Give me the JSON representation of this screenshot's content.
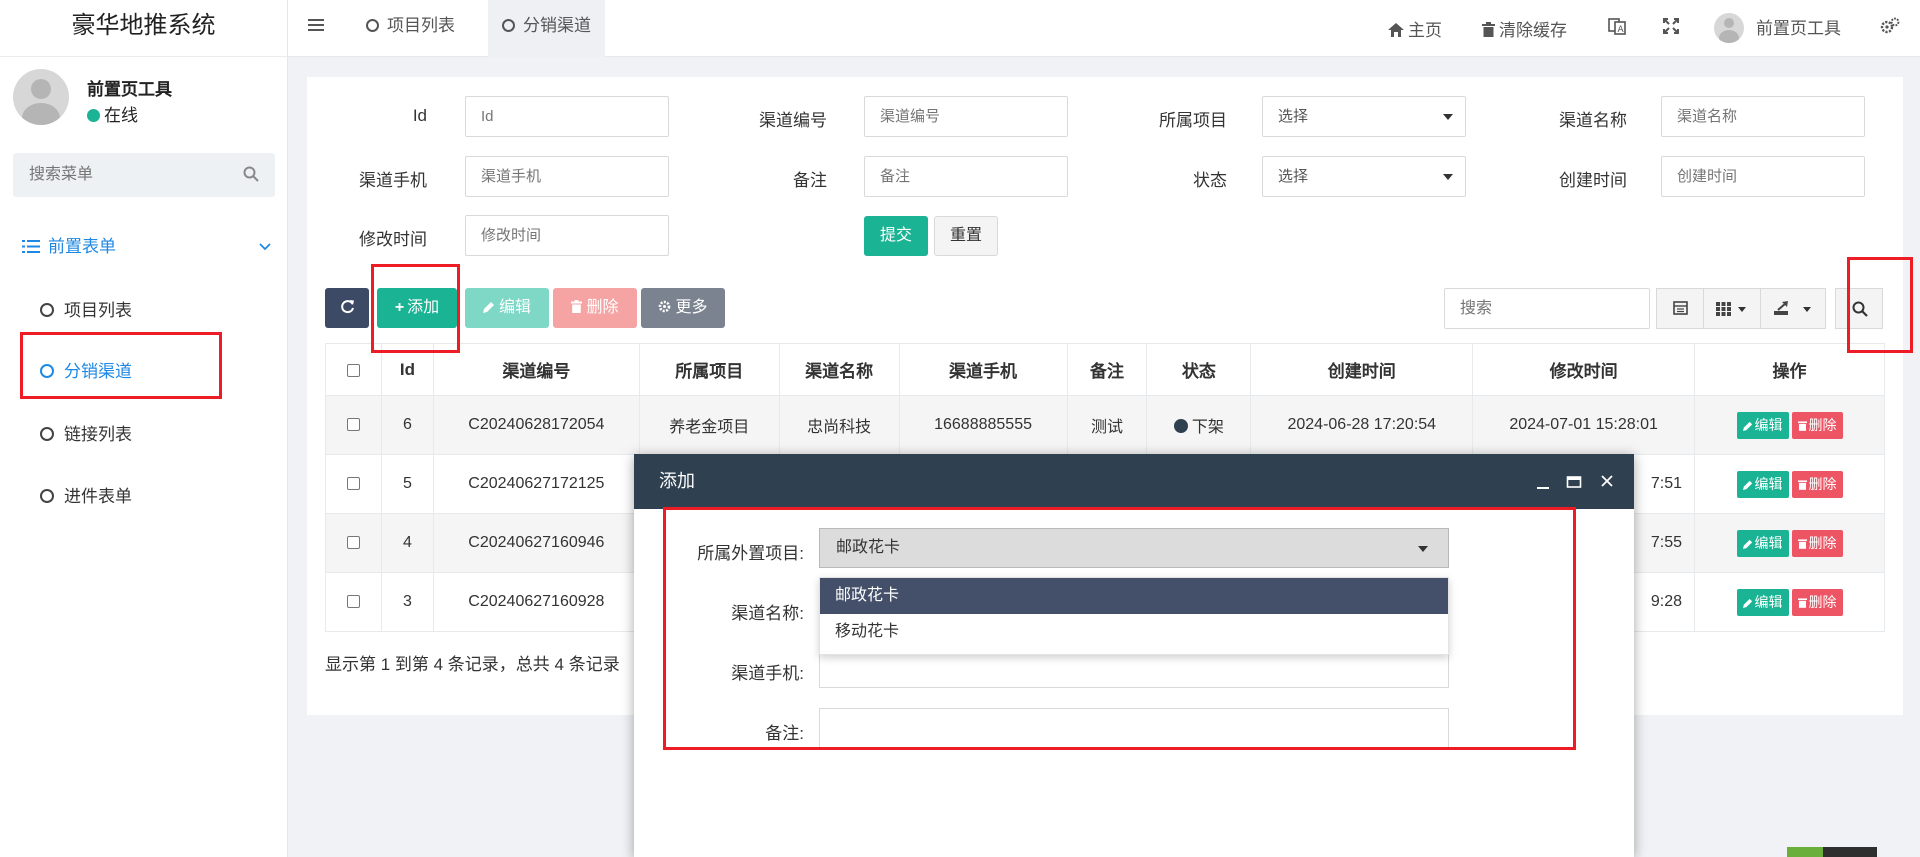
{
  "app": {
    "title": "豪华地推系统"
  },
  "user": {
    "name": "前置页工具",
    "status": "在线"
  },
  "sidebar": {
    "search_placeholder": "搜索菜单",
    "group_label": "前置表单",
    "items": [
      {
        "label": "项目列表"
      },
      {
        "label": "分销渠道"
      },
      {
        "label": "链接列表"
      },
      {
        "label": "进件表单"
      }
    ]
  },
  "topnav": {
    "tabs": [
      {
        "label": "项目列表"
      },
      {
        "label": "分销渠道"
      }
    ],
    "home": "主页",
    "clear_cache": "清除缓存",
    "user_name": "前置页工具"
  },
  "filters": {
    "id_label": "Id",
    "id_placeholder": "Id",
    "code_label": "渠道编号",
    "code_placeholder": "渠道编号",
    "project_label": "所属项目",
    "project_value": "选择",
    "name_label": "渠道名称",
    "name_placeholder": "渠道名称",
    "phone_label": "渠道手机",
    "phone_placeholder": "渠道手机",
    "remark_label": "备注",
    "remark_placeholder": "备注",
    "status_label": "状态",
    "status_value": "选择",
    "created_label": "创建时间",
    "created_placeholder": "创建时间",
    "updated_label": "修改时间",
    "updated_placeholder": "修改时间",
    "submit": "提交",
    "reset": "重置"
  },
  "toolbar": {
    "add": "添加",
    "edit": "编辑",
    "delete": "删除",
    "more": "更多",
    "search_placeholder": "搜索"
  },
  "table": {
    "columns": [
      "Id",
      "渠道编号",
      "所属项目",
      "渠道名称",
      "渠道手机",
      "备注",
      "状态",
      "创建时间",
      "修改时间",
      "操作"
    ],
    "rows": [
      {
        "id": "6",
        "code": "C20240628172054",
        "project": "养老金项目",
        "name": "忠尚科技",
        "phone": "16688885555",
        "remark": "测试",
        "status": "下架",
        "created": "2024-06-28 17:20:54",
        "updated": "2024-07-01 15:28:01"
      },
      {
        "id": "5",
        "code": "C20240627172125",
        "updated": "7:51"
      },
      {
        "id": "4",
        "code": "C20240627160946",
        "updated": "7:55"
      },
      {
        "id": "3",
        "code": "C20240627160928",
        "updated": "9:28"
      }
    ],
    "row_edit": "编辑",
    "row_delete": "删除"
  },
  "pager": {
    "text": "显示第 1 到第 4 条记录，总共 4 条记录"
  },
  "modal": {
    "title": "添加",
    "project_label": "所属外置项目:",
    "project_value": "邮政花卡",
    "name_label": "渠道名称:",
    "phone_label": "渠道手机:",
    "remark_label": "备注:",
    "options": [
      {
        "label": "邮政花卡"
      },
      {
        "label": "移动花卡"
      }
    ]
  },
  "colors": {
    "accent": "#1ab394",
    "brand_dark": "#2f4050",
    "danger": "#ed5565",
    "link": "#1e88e5",
    "annotation": "#ee1c24"
  }
}
